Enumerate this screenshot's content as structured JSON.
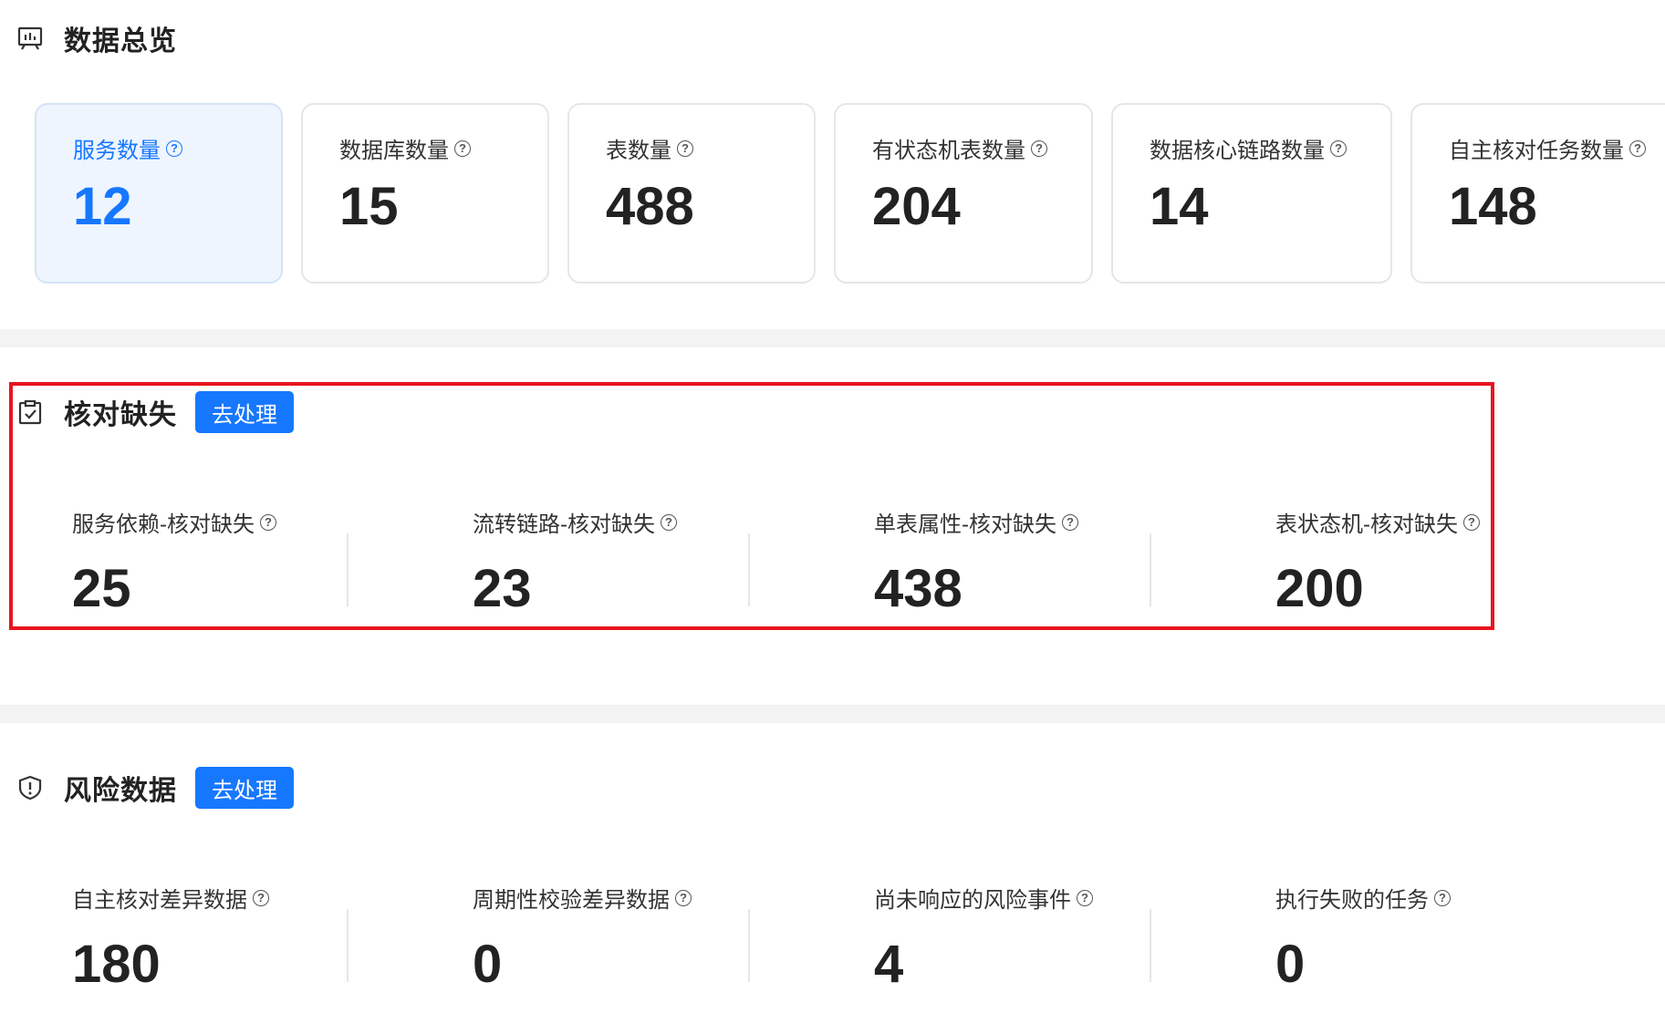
{
  "overview": {
    "title": "数据总览",
    "icon": "monitor-chart-icon",
    "cards": [
      {
        "label": "服务数量",
        "value": "12",
        "active": true
      },
      {
        "label": "数据库数量",
        "value": "15"
      },
      {
        "label": "表数量",
        "value": "488"
      },
      {
        "label": "有状态机表数量",
        "value": "204"
      },
      {
        "label": "数据核心链路数量",
        "value": "14"
      },
      {
        "label": "自主核对任务数量",
        "value": "148"
      }
    ]
  },
  "missing": {
    "title": "核对缺失",
    "icon": "clipboard-check-icon",
    "action_label": "去处理",
    "stats": [
      {
        "label": "服务依赖-核对缺失",
        "value": "25"
      },
      {
        "label": "流转链路-核对缺失",
        "value": "23"
      },
      {
        "label": "单表属性-核对缺失",
        "value": "438"
      },
      {
        "label": "表状态机-核对缺失",
        "value": "200"
      }
    ]
  },
  "risk": {
    "title": "风险数据",
    "icon": "shield-alert-icon",
    "action_label": "去处理",
    "stats": [
      {
        "label": "自主核对差异数据",
        "value": "180"
      },
      {
        "label": "周期性校验差异数据",
        "value": "0"
      },
      {
        "label": "尚未响应的风险事件",
        "value": "4"
      },
      {
        "label": "执行失败的任务",
        "value": "0"
      }
    ]
  },
  "colors": {
    "accent": "#1677ff",
    "highlight": "#e8141f",
    "divider": "#f3f3f4"
  }
}
